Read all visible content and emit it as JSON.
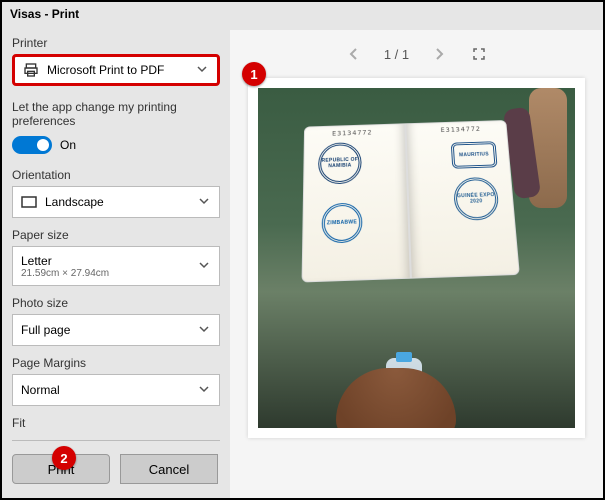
{
  "window": {
    "title": "Visas - Print"
  },
  "labels": {
    "printer": "Printer",
    "pref": "Let the app change my printing preferences",
    "orientation": "Orientation",
    "paper_size": "Paper size",
    "photo_size": "Photo size",
    "page_margins": "Page Margins",
    "fit": "Fit"
  },
  "values": {
    "printer": "Microsoft Print to PDF",
    "toggle_state": "On",
    "orientation": "Landscape",
    "paper_size": "Letter",
    "paper_dims": "21.59cm × 27.94cm",
    "photo_size": "Full page",
    "margins": "Normal"
  },
  "buttons": {
    "print": "Print",
    "cancel": "Cancel"
  },
  "preview": {
    "page_indicator": "1 / 1"
  },
  "callouts": {
    "one": "1",
    "two": "2"
  },
  "passport": {
    "num_l": "E3134772",
    "num_r": "E3134772",
    "stamp1": "REPUBLIC OF NAMIBIA",
    "stamp2": "ZIMBABWE",
    "stamp3": "MAURITIUS",
    "stamp4": "GUINÉE EXPO 2020"
  }
}
